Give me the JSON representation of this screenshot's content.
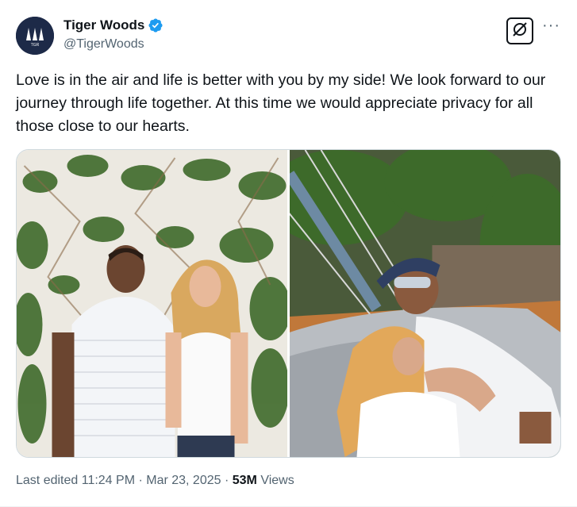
{
  "author": {
    "name": "Tiger Woods",
    "handle": "@TigerWoods",
    "avatar_text": "TGR",
    "verified_icon": "verified-badge-icon",
    "verified_color": "#1d9bf0"
  },
  "actions": {
    "grok_icon": "grok-icon",
    "more_label": "···"
  },
  "tweet": {
    "text": "Love is in the air and life is better with you by my side! We look forward to our journey through life together. At this time we would appreciate privacy for all those close to our hearts."
  },
  "media": [
    {
      "description_icon": "photo-couple-wall"
    },
    {
      "description_icon": "photo-couple-hammock"
    }
  ],
  "meta": {
    "edited": "Last edited 11:24 PM · Mar 23, 2025 · ",
    "views_count": "53M",
    "views_label": " Views"
  }
}
